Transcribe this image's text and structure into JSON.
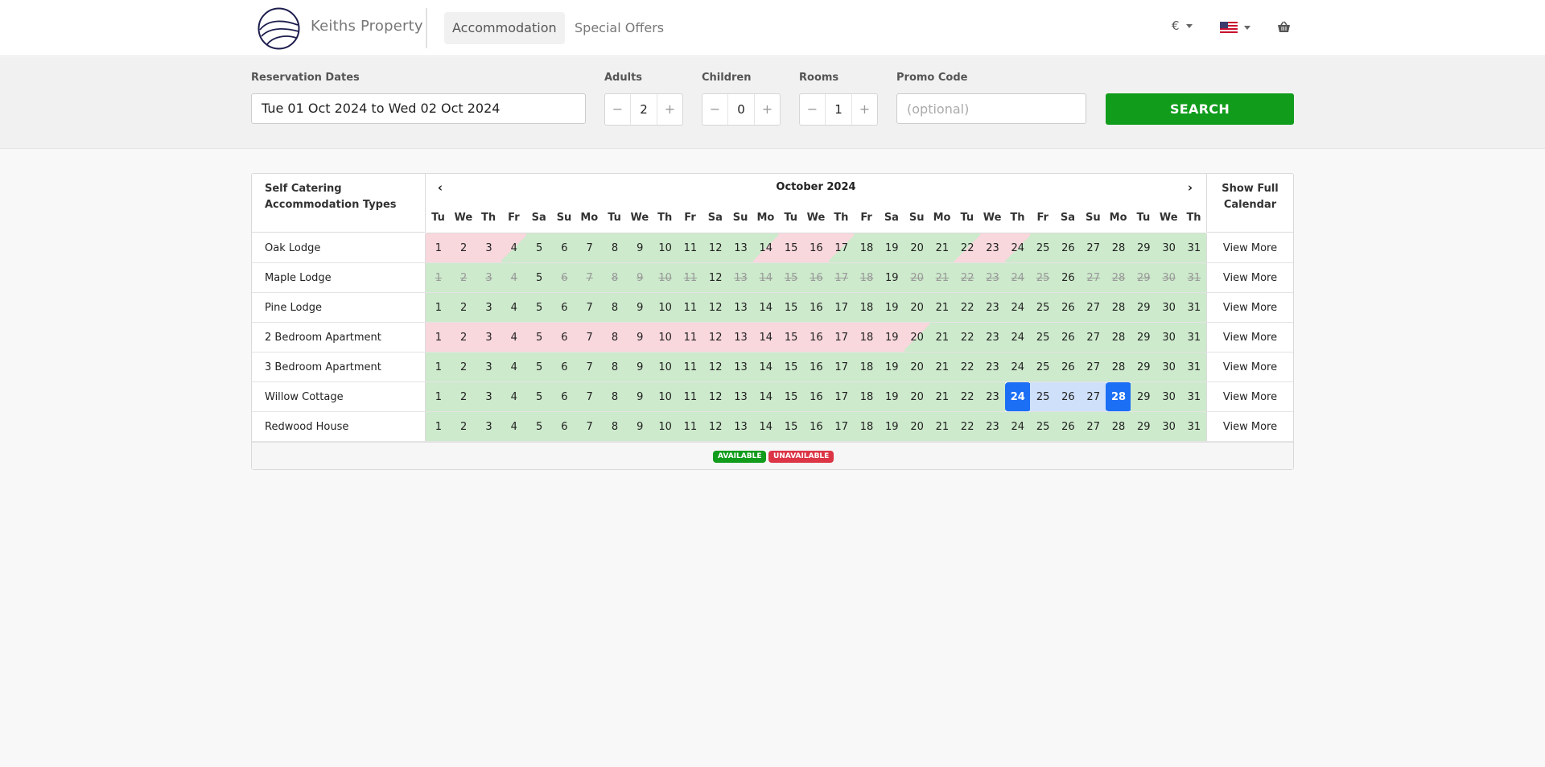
{
  "header": {
    "brand": "Keiths Property",
    "nav": [
      {
        "label": "Accommodation",
        "active": true
      },
      {
        "label": "Special Offers",
        "active": false
      }
    ],
    "currency": "€",
    "language_icon": "us-flag-icon",
    "basket_icon": "basket-icon"
  },
  "search": {
    "dates_label": "Reservation Dates",
    "dates_value": "Tue 01 Oct 2024 to Wed 02 Oct 2024",
    "adults_label": "Adults",
    "adults_value": "2",
    "children_label": "Children",
    "children_value": "0",
    "rooms_label": "Rooms",
    "rooms_value": "1",
    "promo_label": "Promo Code",
    "promo_placeholder": "(optional)",
    "search_button": "SEARCH",
    "minus": "−",
    "plus": "+"
  },
  "calendar": {
    "header_left": "Self Catering Accommodation Types",
    "header_right": "Show Full Calendar",
    "month": "October 2024",
    "prev_icon": "‹",
    "next_icon": "›",
    "weekdays": [
      "Tu",
      "We",
      "Th",
      "Fr",
      "Sa",
      "Su",
      "Mo",
      "Tu",
      "We",
      "Th",
      "Fr",
      "Sa",
      "Su",
      "Mo",
      "Tu",
      "We",
      "Th",
      "Fr",
      "Sa",
      "Su",
      "Mo",
      "Tu",
      "We",
      "Th",
      "Fr",
      "Sa",
      "Su",
      "Mo",
      "Tu",
      "We",
      "Th"
    ],
    "view_more": "View More",
    "rows": [
      {
        "name": "Oak Lodge",
        "unavailable": [
          1,
          2,
          3,
          14,
          15,
          16,
          22,
          23
        ],
        "split_au": [
          14,
          22
        ],
        "split_ua": [
          4,
          17,
          24
        ],
        "blocked": [],
        "selected_ends": [],
        "selected_mid": []
      },
      {
        "name": "Maple Lodge",
        "unavailable": [],
        "split_au": [],
        "split_ua": [],
        "blocked": [
          1,
          2,
          3,
          4,
          6,
          7,
          8,
          9,
          10,
          11,
          13,
          14,
          15,
          16,
          17,
          18,
          20,
          21,
          22,
          23,
          24,
          25,
          27,
          28,
          29,
          30,
          31
        ],
        "selected_ends": [],
        "selected_mid": []
      },
      {
        "name": "Pine Lodge",
        "unavailable": [],
        "split_au": [],
        "split_ua": [],
        "blocked": [],
        "selected_ends": [],
        "selected_mid": []
      },
      {
        "name": "2 Bedroom Apartment",
        "unavailable": [
          1,
          2,
          3,
          4,
          5,
          6,
          7,
          8,
          9,
          10,
          11,
          12,
          13,
          14,
          15,
          16,
          17,
          18,
          19
        ],
        "split_au": [],
        "split_ua": [
          20
        ],
        "blocked": [],
        "selected_ends": [],
        "selected_mid": []
      },
      {
        "name": "3 Bedroom Apartment",
        "unavailable": [],
        "split_au": [],
        "split_ua": [],
        "blocked": [],
        "selected_ends": [],
        "selected_mid": []
      },
      {
        "name": "Willow Cottage",
        "unavailable": [],
        "split_au": [],
        "split_ua": [],
        "blocked": [],
        "selected_ends": [
          24,
          28
        ],
        "selected_mid": [
          25,
          26,
          27
        ]
      },
      {
        "name": "Redwood House",
        "unavailable": [],
        "split_au": [],
        "split_ua": [],
        "blocked": [],
        "selected_ends": [],
        "selected_mid": []
      }
    ],
    "legend_available": "AVAILABLE",
    "legend_unavailable": "UNAVAILABLE",
    "colors": {
      "available": "#cdeacc",
      "unavailable": "#f8d7dd",
      "selected": "#1b6ff5",
      "legend_green": "#119c1c",
      "legend_red": "#dc3545"
    }
  }
}
